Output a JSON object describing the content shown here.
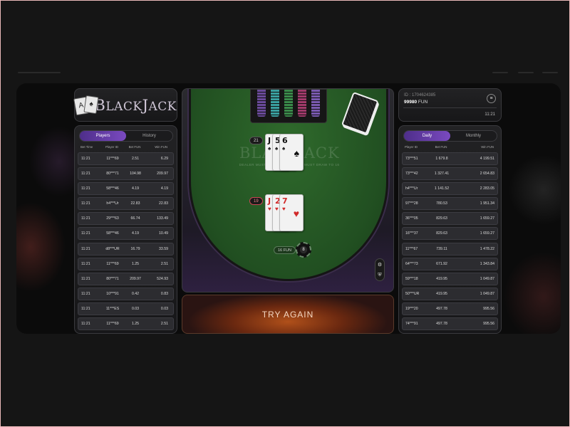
{
  "brand": {
    "logo_text_a": "B",
    "logo_text_b": "LACK",
    "logo_text_c": "J",
    "logo_text_d": "ACK",
    "logo_card_a": "A",
    "logo_card_b": "♠"
  },
  "left_panel": {
    "tabs": [
      {
        "label": "Players",
        "active": true
      },
      {
        "label": "History",
        "active": false
      }
    ],
    "columns": [
      "Bet Time",
      "Player ID",
      "Bet FUN",
      "Win FUN"
    ],
    "rows": [
      [
        "11:21",
        "11***69",
        "2.51",
        "6.29"
      ],
      [
        "11:21",
        "80***71",
        "104.98",
        "209.97"
      ],
      [
        "11:21",
        "58***46",
        "4.19",
        "4.19"
      ],
      [
        "11:21",
        "h4***Ur",
        "22.83",
        "22.83"
      ],
      [
        "11:21",
        "29***63",
        "66.74",
        "133.49"
      ],
      [
        "11:21",
        "58***46",
        "4.19",
        "10.49"
      ],
      [
        "11:21",
        "d8***UR",
        "16.79",
        "33.59"
      ],
      [
        "11:21",
        "11***69",
        "1.25",
        "2.51"
      ],
      [
        "11:21",
        "80***71",
        "209.97",
        "524.93"
      ],
      [
        "11:21",
        "10***91",
        "0.42",
        "0.83"
      ],
      [
        "11:21",
        "11***ES",
        "0.03",
        "0.03"
      ],
      [
        "11:21",
        "11***69",
        "1.25",
        "2.51"
      ]
    ]
  },
  "account": {
    "id": "ID : 1704624385",
    "balance": "99980",
    "currency": "FUN",
    "time": "11:21",
    "menu_icon": "≡"
  },
  "right_panel": {
    "tabs": [
      {
        "label": "Daily",
        "active": true
      },
      {
        "label": "Monthly",
        "active": false
      }
    ],
    "columns": [
      "Player ID",
      "Bet FUN",
      "Win FUN"
    ],
    "rows": [
      [
        "73***51",
        "1 679.8",
        "4 199.51"
      ],
      [
        "73***42",
        "1 327.41",
        "2 654.83"
      ],
      [
        "h4***Ur",
        "1 141.52",
        "2 283.05"
      ],
      [
        "97***28",
        "780.53",
        "1 951.34"
      ],
      [
        "36***05",
        "829.63",
        "1 659.27"
      ],
      [
        "16***37",
        "829.63",
        "1 659.27"
      ],
      [
        "11***67",
        "739.11",
        "1 478.22"
      ],
      [
        "64***73",
        "671.92",
        "1 343.84"
      ],
      [
        "59***18",
        "419.95",
        "1 049.87"
      ],
      [
        "50***UR",
        "419.95",
        "1 049.87"
      ],
      [
        "19***20",
        "497.78",
        "995.56"
      ],
      [
        "74***91",
        "497.78",
        "995.56"
      ]
    ]
  },
  "table": {
    "watermark": "BLACKJACK",
    "rule_text": "DEALER MUST STAND ON 17, AND MUST DRAW TO 16",
    "dealer_score": "21",
    "player_score": "19",
    "dealer_cards": [
      {
        "rank": "J",
        "suit": "♠"
      },
      {
        "rank": "5",
        "suit": "♠"
      },
      {
        "rank": "6",
        "suit": "♠"
      }
    ],
    "player_cards": [
      {
        "rank": "J",
        "suit": "♥"
      },
      {
        "rank": "2",
        "suit": "♥"
      },
      {
        "rank": "7",
        "suit": "♥"
      }
    ],
    "bet_amount": "16",
    "bet_currency": "FUN",
    "chip_value": "8",
    "chip_colors": [
      "#6a4a9a",
      "#3aa0a0",
      "#3a8a4a",
      "#a03a6a",
      "#7a5ab0"
    ],
    "settings_icon": "⚙",
    "shield_icon": "⛨"
  },
  "action": {
    "label": "TRY AGAIN"
  }
}
